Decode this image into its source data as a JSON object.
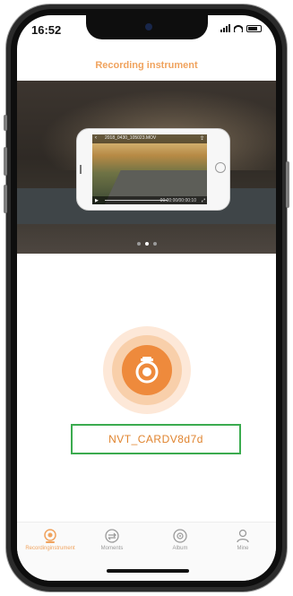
{
  "status_bar": {
    "time": "16:52"
  },
  "header": {
    "title": "Recording instrument"
  },
  "banner": {
    "video": {
      "file_name": "2018_0430_105023.MOV",
      "timestamp": "00:00:00/00:00:10"
    },
    "pager": {
      "count": 3,
      "active_index": 1
    }
  },
  "device": {
    "name": "NVT_CARDV8d7d"
  },
  "tabbar": {
    "tabs": [
      {
        "label": "Recordinginstrument",
        "icon": "camera-icon",
        "active": true
      },
      {
        "label": "Moments",
        "icon": "moments-icon",
        "active": false
      },
      {
        "label": "Album",
        "icon": "album-icon",
        "active": false
      },
      {
        "label": "Mine",
        "icon": "person-icon",
        "active": false
      }
    ]
  },
  "colors": {
    "accent": "#ee8a3c",
    "title": "#f0a35e",
    "highlight_border": "#3bab4f",
    "inactive": "#9a9a9a"
  }
}
